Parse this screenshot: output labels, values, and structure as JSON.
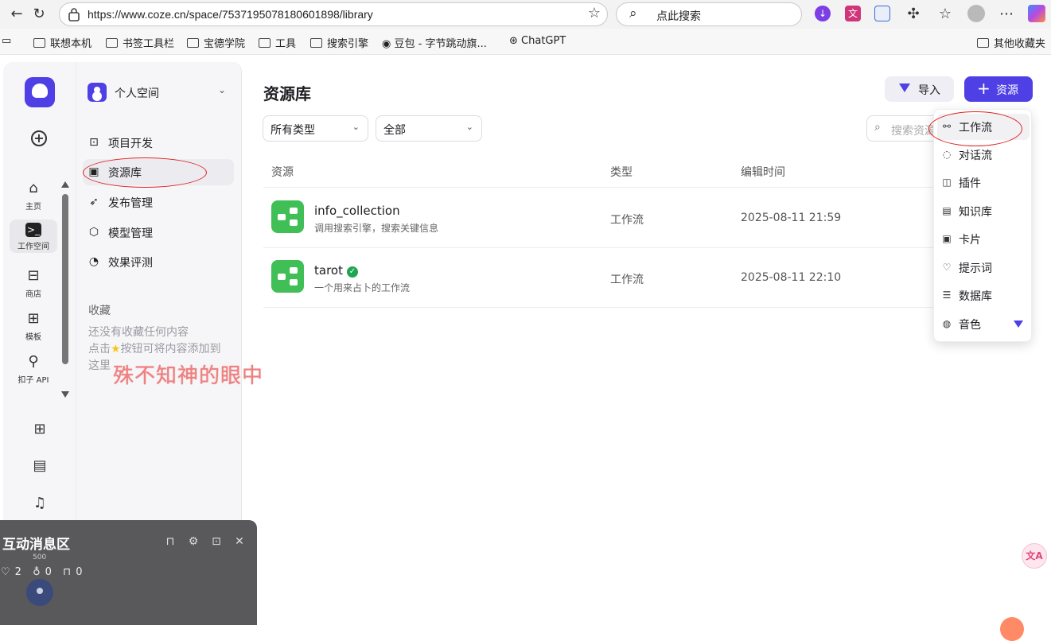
{
  "browser": {
    "url": "https://www.coze.cn/space/7537195078180601898/library",
    "search_placeholder": "点此搜索",
    "bookmarks": [
      "联想本机",
      "书签工具栏",
      "宝德学院",
      "工具",
      "搜索引擎",
      "豆包 - 字节跳动旗...",
      "ChatGPT",
      "其他收藏夹"
    ]
  },
  "rail": {
    "items": [
      {
        "label": "主页",
        "icon": "home-icon"
      },
      {
        "label": "工作空间",
        "icon": "workspace-icon"
      },
      {
        "label": "商店",
        "icon": "store-icon"
      },
      {
        "label": "模板",
        "icon": "template-icon"
      },
      {
        "label": "扣子 API",
        "icon": "api-icon"
      }
    ]
  },
  "sidebar": {
    "space_name": "个人空间",
    "menu": [
      {
        "label": "项目开发",
        "icon": "project-icon"
      },
      {
        "label": "资源库",
        "icon": "library-icon"
      },
      {
        "label": "发布管理",
        "icon": "rocket-icon"
      },
      {
        "label": "模型管理",
        "icon": "model-icon"
      },
      {
        "label": "效果评测",
        "icon": "gauge-icon"
      }
    ],
    "favorites_title": "收藏",
    "favorites_empty_1": "还没有收藏任何内容",
    "favorites_empty_2": "点击",
    "favorites_empty_3": "按钮可将内容添加到",
    "favorites_empty_4": "这里"
  },
  "main": {
    "title": "资源库",
    "import_label": "导入",
    "add_label": "资源",
    "filter_type": "所有类型",
    "filter_scope": "全部",
    "search_placeholder": "搜索资源",
    "columns": {
      "resource": "资源",
      "type": "类型",
      "edited": "编辑时间"
    },
    "rows": [
      {
        "name": "info_collection",
        "desc": "调用搜索引擎，搜索关键信息",
        "type": "工作流",
        "time": "2025-08-11 21:59"
      },
      {
        "name": "tarot",
        "desc": "一个用来占卜的工作流",
        "type": "工作流",
        "time": "2025-08-11 22:10"
      }
    ]
  },
  "dropdown": {
    "items": [
      {
        "label": "工作流",
        "icon": "workflow-icon"
      },
      {
        "label": "对话流",
        "icon": "chatflow-icon"
      },
      {
        "label": "插件",
        "icon": "plugin-icon"
      },
      {
        "label": "知识库",
        "icon": "knowledge-icon"
      },
      {
        "label": "卡片",
        "icon": "card-icon"
      },
      {
        "label": "提示词",
        "icon": "prompt-icon"
      },
      {
        "label": "数据库",
        "icon": "database-icon"
      },
      {
        "label": "音色",
        "icon": "voice-icon"
      }
    ]
  },
  "overlay_text": "殊不知神的眼中",
  "message_panel": {
    "title": "互动消息区",
    "likes": "2",
    "users": "0",
    "gifts": "0",
    "small_count": "500"
  },
  "colors": {
    "brand": "#4e40e5",
    "workflow_green": "#3fbf55",
    "annotation_red": "#e02020"
  }
}
